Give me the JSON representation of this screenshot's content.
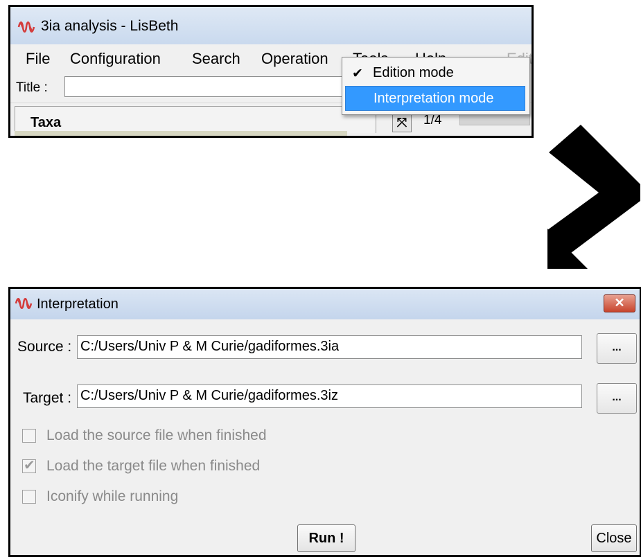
{
  "main_window": {
    "title": "3ia analysis - LisBeth",
    "menu": [
      "File",
      "Configuration",
      "Search",
      "Operation",
      "Tools",
      "Help",
      "Edit"
    ],
    "title_field_label": "Title :",
    "title_field_value": "",
    "taxa_header": "Taxa",
    "expand_icon": "expand-icon",
    "counter": "1/4",
    "mode_dropdown": {
      "items": [
        {
          "label": "Edition mode",
          "checked": true
        },
        {
          "label": "Interpretation mode",
          "highlighted": true
        }
      ]
    }
  },
  "dialog": {
    "title": "Interpretation",
    "close_glyph": "✕",
    "source_label": "Source :",
    "source_value": "C:/Users/Univ P & M Curie/gadiformes.3ia",
    "target_label": "Target :",
    "target_value": "C:/Users/Univ P & M Curie/gadiformes.3iz",
    "browse_label": "...",
    "options": [
      {
        "label": "Load the source file when finished",
        "checked": false
      },
      {
        "label": "Load the target file when finished",
        "checked": true
      },
      {
        "label": "Iconify while running",
        "checked": false
      }
    ],
    "run_label": "Run !",
    "close_label": "Close"
  },
  "colors": {
    "highlight": "#3399ff",
    "titlebar": "#c9d9ee",
    "close_button": "#c8442d",
    "icon_red": "#d43c3c"
  }
}
